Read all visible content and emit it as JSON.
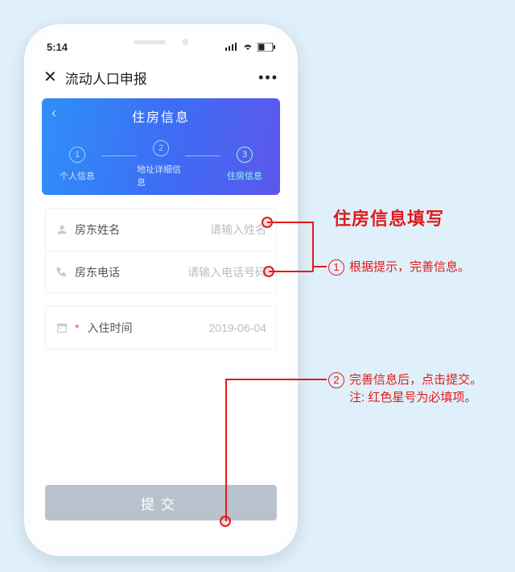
{
  "statusbar": {
    "time": "5:14"
  },
  "navbar": {
    "title": "流动人口申报"
  },
  "hero": {
    "title": "住房信息",
    "steps": [
      {
        "num": "1",
        "label": "个人信息"
      },
      {
        "num": "2",
        "label": "地址详细信息"
      },
      {
        "num": "3",
        "label": "住房信息"
      }
    ]
  },
  "fields": {
    "landlord_name": {
      "label": "房东姓名",
      "placeholder": "请输入姓名"
    },
    "landlord_phone": {
      "label": "房东电话",
      "placeholder": "请输入电话号码"
    },
    "checkin_date": {
      "label": "入住时间",
      "value": "2019-06-04",
      "required_mark": "*"
    }
  },
  "submit_label": "提交",
  "annotations": {
    "title": "住房信息填写",
    "a1": {
      "num": "1",
      "text": "根据提示，完善信息。"
    },
    "a2": {
      "num": "2",
      "text": "完善信息后，点击提交。",
      "note": "注: 红色星号为必填项。"
    }
  }
}
